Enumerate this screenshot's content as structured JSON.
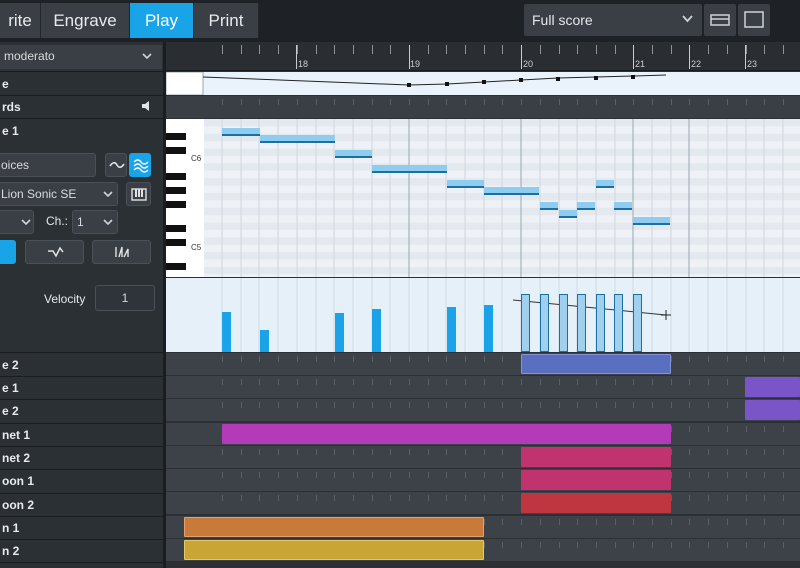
{
  "toolbar": {
    "tabs": [
      {
        "label": "rite"
      },
      {
        "label": "Engrave"
      },
      {
        "label": "Play"
      },
      {
        "label": "Print"
      }
    ],
    "layout_select": "Full score"
  },
  "left_panel": {
    "tempo_select": "moderato",
    "track_labels": {
      "tempo": "e",
      "chords": "rds",
      "piano1": "e 1"
    },
    "voices_field": "oices",
    "sound_select": "Lion Sonic SE",
    "channel_label": "Ch.:",
    "channel_value": "1",
    "velocity_label": "Velocity",
    "velocity_value": "1",
    "lanes": [
      {
        "label": "e 2"
      },
      {
        "label": "e 1"
      },
      {
        "label": "e 2"
      },
      {
        "label": "net 1"
      },
      {
        "label": "net 2"
      },
      {
        "label": "oon 1"
      },
      {
        "label": "oon 2"
      },
      {
        "label": "n 1"
      },
      {
        "label": "n 2"
      }
    ]
  },
  "ruler": {
    "bars": [
      "18",
      "19",
      "20",
      "21",
      "22",
      "23"
    ]
  },
  "piano_roll": {
    "c6_label": "C6",
    "c5_label": "C5"
  },
  "colors": {
    "accent": "#19a4e8",
    "region_blue": "#5a6fc0",
    "region_purple": "#7a55c8",
    "region_magenta": "#b33ab8",
    "region_pink": "#c0336e",
    "region_red": "#c03640",
    "region_orange": "#c87a3a",
    "region_yellow": "#c8a535"
  }
}
